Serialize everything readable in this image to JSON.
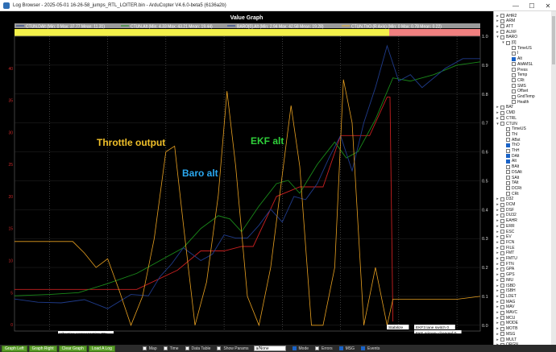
{
  "window": {
    "title": "Log Browser - 2025-05-01 16-26-58_jumps_RTL_LOITER.bin - ArduCopter V4.6.0-beta5 (6136a2b)",
    "minimize": "—",
    "maximize": "☐",
    "close": "✕"
  },
  "graph": {
    "title": "Value Graph",
    "xlabel": "Line Number (10^3)",
    "legend": [
      {
        "label": "CTUN.DAlt (Min: 0 Max: 37.77 Mean: 11.31)",
        "color": "#1f3b8a"
      },
      {
        "label": "CTUN.Alt (Min: 4.33 Max: 43.21 Mean: 19.44)",
        "color": "#1a8a1a"
      },
      {
        "label": "BARO[0].Alt (Min: 2.94 Max: 42.58 Mean: 19.28)",
        "color": "#1f3b8a"
      },
      {
        "label": "CTUN.ThO (R Axis) (Min: 0 Max: 0.78 Mean: 0.22)",
        "color": "#e8b53a"
      }
    ],
    "x_ticks": [
      "236",
      "237",
      "238",
      "239",
      "240",
      "241",
      "242",
      "243"
    ],
    "left_ticks": [
      "40",
      "35",
      "30",
      "25",
      "20",
      "15",
      "10",
      "5",
      "0"
    ],
    "right_ticks": [
      "1.0",
      "0.9",
      "0.8",
      "0.7",
      "0.6",
      "0.5",
      "0.4",
      "0.3",
      "0.2",
      "0.1",
      "0.0"
    ],
    "messages": [
      {
        "text": "Vibration compensation ON"
      },
      {
        "text": "Stabilize"
      },
      {
        "text": "EKF3 lane switch 0"
      },
      {
        "text": "EKF primary changed:0"
      }
    ],
    "annotations": [
      {
        "text": "Throttle output",
        "color": "#f0c02a"
      },
      {
        "text": "Baro alt",
        "color": "#2aa8f0"
      },
      {
        "text": "EKF alt",
        "color": "#2fcf3a"
      }
    ],
    "corner_label": "scaled output throttle"
  },
  "chart_data": {
    "type": "line",
    "xlabel": "Line Number (10^3)",
    "xlim": [
      235.4,
      243.4
    ],
    "left_ylim": [
      -1,
      45
    ],
    "right_ylim": [
      -0.02,
      1.0
    ],
    "series": [
      {
        "name": "CTUN.DAlt",
        "axis": "left",
        "color": "#c82020",
        "x": [
          235.4,
          237.5,
          238.2,
          238.6,
          239.0,
          239.3,
          239.5,
          239.9,
          240.3,
          240.7,
          241.0,
          241.5,
          241.8,
          241.85,
          241.9
        ],
        "y": [
          5.5,
          5.5,
          8.5,
          11.5,
          11.5,
          12.2,
          12.2,
          20.0,
          21.5,
          21.5,
          29.5,
          29.5,
          35.5,
          35.5,
          0.5
        ]
      },
      {
        "name": "CTUN.Alt",
        "axis": "left",
        "color": "#1a8a1a",
        "x": [
          235.4,
          236.0,
          236.5,
          237.0,
          237.5,
          237.8,
          238.0,
          238.3,
          238.6,
          238.9,
          239.1,
          239.3,
          239.6,
          239.9,
          240.1,
          240.3,
          240.6,
          240.9,
          241.1,
          241.3,
          241.6,
          241.9,
          242.2,
          242.6,
          243.0,
          243.4
        ],
        "y": [
          4.5,
          4.7,
          5.0,
          6.4,
          8.0,
          9.5,
          10.5,
          12.0,
          15.0,
          17.0,
          16.5,
          14.5,
          18.5,
          22.0,
          22.5,
          20.5,
          25.0,
          28.5,
          26.0,
          27.0,
          32.0,
          38.5,
          38.0,
          39.0,
          40.5,
          41.0
        ]
      },
      {
        "name": "BARO[0].Alt",
        "axis": "left",
        "color": "#1f3b8a",
        "x": [
          235.4,
          235.8,
          236.2,
          236.6,
          237.0,
          237.4,
          237.7,
          237.9,
          238.1,
          238.3,
          238.6,
          238.8,
          239.0,
          239.2,
          239.4,
          239.6,
          239.8,
          240.0,
          240.2,
          240.4,
          240.6,
          240.8,
          241.0,
          241.2,
          241.4,
          241.6,
          241.8,
          242.0,
          242.2,
          242.4,
          242.8,
          243.1,
          243.4
        ],
        "y": [
          4.0,
          3.5,
          3.4,
          3.9,
          2.5,
          4.7,
          4.5,
          7.5,
          9.5,
          12.0,
          10.0,
          11.0,
          14.0,
          13.5,
          13.5,
          15.5,
          18.0,
          16.0,
          20.0,
          19.5,
          22.0,
          26.0,
          29.5,
          24.0,
          31.5,
          37.0,
          43.5,
          38.0,
          39.0,
          37.0,
          40.0,
          41.5,
          41.5
        ]
      },
      {
        "name": "CTUN.ThO",
        "axis": "right",
        "color": "#e8a020",
        "x": [
          235.4,
          236.4,
          236.6,
          236.8,
          237.0,
          237.2,
          237.4,
          237.6,
          237.8,
          238.0,
          238.15,
          238.3,
          238.5,
          238.7,
          238.9,
          239.05,
          239.2,
          239.4,
          239.6,
          239.8,
          240.0,
          240.15,
          240.3,
          240.5,
          240.7,
          240.9,
          241.05,
          241.2,
          241.4,
          241.6,
          241.8,
          241.9,
          242.2,
          242.6,
          243.0,
          243.4
        ],
        "y": [
          0.29,
          0.29,
          0.25,
          0.2,
          0.23,
          0.12,
          0.0,
          0.1,
          0.3,
          0.6,
          0.62,
          0.35,
          0.0,
          0.15,
          0.45,
          0.81,
          0.55,
          0.1,
          0.0,
          0.2,
          0.52,
          0.76,
          0.55,
          0.0,
          0.0,
          0.2,
          0.85,
          0.7,
          0.0,
          0.2,
          0.0,
          0.09,
          0.09,
          0.09,
          0.09,
          0.1
        ]
      }
    ]
  },
  "tree": {
    "items": [
      {
        "label": "AHR2",
        "indent": 0,
        "exp": "+",
        "checked": false
      },
      {
        "label": "ARM",
        "indent": 0,
        "exp": "+",
        "checked": false
      },
      {
        "label": "ATT",
        "indent": 0,
        "exp": "+",
        "checked": false
      },
      {
        "label": "AUXF",
        "indent": 0,
        "exp": "+",
        "checked": false
      },
      {
        "label": "BARO",
        "indent": 0,
        "exp": "-",
        "checked": false
      },
      {
        "label": "[0]",
        "indent": 1,
        "exp": "-",
        "checked": false
      },
      {
        "label": "TimeUS",
        "indent": 2,
        "exp": "",
        "checked": false
      },
      {
        "label": "I",
        "indent": 2,
        "exp": "",
        "checked": false
      },
      {
        "label": "Alt",
        "indent": 2,
        "exp": "",
        "checked": true
      },
      {
        "label": "AltAMSL",
        "indent": 2,
        "exp": "",
        "checked": false
      },
      {
        "label": "Press",
        "indent": 2,
        "exp": "",
        "checked": false
      },
      {
        "label": "Temp",
        "indent": 2,
        "exp": "",
        "checked": false
      },
      {
        "label": "CRt",
        "indent": 2,
        "exp": "",
        "checked": false
      },
      {
        "label": "SMS",
        "indent": 2,
        "exp": "",
        "checked": false
      },
      {
        "label": "Offset",
        "indent": 2,
        "exp": "",
        "checked": false
      },
      {
        "label": "GndTemp",
        "indent": 2,
        "exp": "",
        "checked": false
      },
      {
        "label": "Health",
        "indent": 2,
        "exp": "",
        "checked": false
      },
      {
        "label": "BAT",
        "indent": 0,
        "exp": "+",
        "checked": false
      },
      {
        "label": "CMD",
        "indent": 0,
        "exp": "+",
        "checked": false
      },
      {
        "label": "CTRL",
        "indent": 0,
        "exp": "+",
        "checked": false
      },
      {
        "label": "CTUN",
        "indent": 0,
        "exp": "-",
        "checked": false
      },
      {
        "label": "TimeUS",
        "indent": 1,
        "exp": "",
        "checked": false
      },
      {
        "label": "ThI",
        "indent": 1,
        "exp": "",
        "checked": false
      },
      {
        "label": "ABst",
        "indent": 1,
        "exp": "",
        "checked": false
      },
      {
        "label": "ThO",
        "indent": 1,
        "exp": "",
        "checked": true
      },
      {
        "label": "ThH",
        "indent": 1,
        "exp": "",
        "checked": false
      },
      {
        "label": "DAlt",
        "indent": 1,
        "exp": "",
        "checked": true
      },
      {
        "label": "Alt",
        "indent": 1,
        "exp": "",
        "checked": true
      },
      {
        "label": "BAlt",
        "indent": 1,
        "exp": "",
        "checked": false
      },
      {
        "label": "DSAlt",
        "indent": 1,
        "exp": "",
        "checked": false
      },
      {
        "label": "SAlt",
        "indent": 1,
        "exp": "",
        "checked": false
      },
      {
        "label": "TAlt",
        "indent": 1,
        "exp": "",
        "checked": false
      },
      {
        "label": "DCRt",
        "indent": 1,
        "exp": "",
        "checked": false
      },
      {
        "label": "CRt",
        "indent": 1,
        "exp": "",
        "checked": false
      },
      {
        "label": "D32",
        "indent": 0,
        "exp": "+",
        "checked": false
      },
      {
        "label": "DCM",
        "indent": 0,
        "exp": "+",
        "checked": false
      },
      {
        "label": "DSF",
        "indent": 0,
        "exp": "+",
        "checked": false
      },
      {
        "label": "DU32",
        "indent": 0,
        "exp": "+",
        "checked": false
      },
      {
        "label": "EAHR",
        "indent": 0,
        "exp": "+",
        "checked": false
      },
      {
        "label": "ERR",
        "indent": 0,
        "exp": "+",
        "checked": false
      },
      {
        "label": "ESC",
        "indent": 0,
        "exp": "+",
        "checked": false
      },
      {
        "label": "EV",
        "indent": 0,
        "exp": "+",
        "checked": false
      },
      {
        "label": "FCN",
        "indent": 0,
        "exp": "+",
        "checked": false
      },
      {
        "label": "FILE",
        "indent": 0,
        "exp": "+",
        "checked": false
      },
      {
        "label": "FMT",
        "indent": 0,
        "exp": "+",
        "checked": false
      },
      {
        "label": "FMTU",
        "indent": 0,
        "exp": "+",
        "checked": false
      },
      {
        "label": "FTN",
        "indent": 0,
        "exp": "+",
        "checked": false
      },
      {
        "label": "GPA",
        "indent": 0,
        "exp": "+",
        "checked": false
      },
      {
        "label": "GPS",
        "indent": 0,
        "exp": "+",
        "checked": false
      },
      {
        "label": "IMU",
        "indent": 0,
        "exp": "+",
        "checked": false
      },
      {
        "label": "ISBD",
        "indent": 0,
        "exp": "+",
        "checked": false
      },
      {
        "label": "ISBH",
        "indent": 0,
        "exp": "+",
        "checked": false
      },
      {
        "label": "LDET",
        "indent": 0,
        "exp": "+",
        "checked": false
      },
      {
        "label": "MAG",
        "indent": 0,
        "exp": "+",
        "checked": false
      },
      {
        "label": "MAV",
        "indent": 0,
        "exp": "+",
        "checked": false
      },
      {
        "label": "MAVC",
        "indent": 0,
        "exp": "+",
        "checked": false
      },
      {
        "label": "MCU",
        "indent": 0,
        "exp": "+",
        "checked": false
      },
      {
        "label": "MODE",
        "indent": 0,
        "exp": "+",
        "checked": false
      },
      {
        "label": "MOTB",
        "indent": 0,
        "exp": "+",
        "checked": false
      },
      {
        "label": "MSG",
        "indent": 0,
        "exp": "+",
        "checked": false
      },
      {
        "label": "MULT",
        "indent": 0,
        "exp": "+",
        "checked": false
      },
      {
        "label": "ORGN",
        "indent": 0,
        "exp": "+",
        "checked": false
      }
    ]
  },
  "toolbar": {
    "graph_left": "Graph Left",
    "graph_right": "Graph Right",
    "clear_graph": "Clear Graph",
    "load_a_log": "Load A Log",
    "map": "Map",
    "time": "Time",
    "data_table": "Data Table",
    "show_params": "Show Params",
    "combo_value": "a/None",
    "mode": "Mode",
    "errors": "Errors",
    "msg": "MSG",
    "events": "Events"
  }
}
